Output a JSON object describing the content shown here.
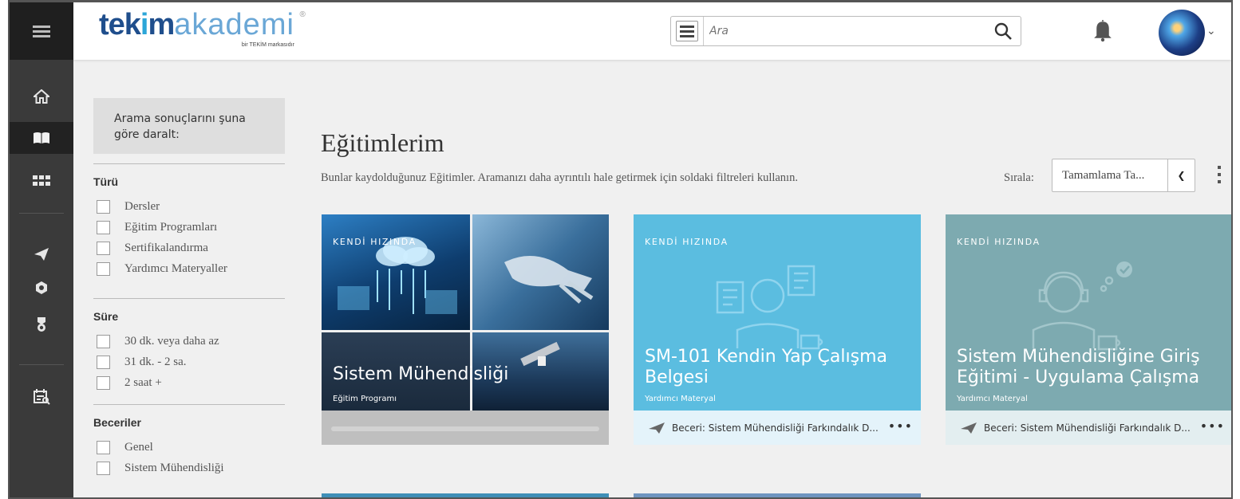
{
  "header": {
    "logo_brand_a": "tek",
    "logo_brand_i": "i",
    "logo_brand_b": "m",
    "logo_brand_c": "akademi",
    "logo_reg": "®",
    "logo_sub": "bir TEKİM markasıdır",
    "search_placeholder": "Ara"
  },
  "filters": {
    "heading": "Arama sonuçlarını şuna göre daralt:",
    "sections": [
      {
        "title": "Türü",
        "options": [
          "Dersler",
          "Eğitim Programları",
          "Sertifikalandırma",
          "Yardımcı Materyaller"
        ]
      },
      {
        "title": "Süre",
        "options": [
          "30 dk. veya daha az",
          "31 dk. - 2 sa.",
          "2 saat +"
        ]
      },
      {
        "title": "Beceriler",
        "options": [
          "Genel",
          "Sistem Mühendisliği"
        ]
      }
    ]
  },
  "main": {
    "title": "Eğitimlerim",
    "description": "Bunlar kaydolduğunuz Eğitimler. Aramanızı daha ayrıntılı hale getirmek için soldaki filtreleri kullanın.",
    "sort_label": "Sırala:",
    "sort_value": "Tamamlama Ta..."
  },
  "cards": [
    {
      "tag": "KENDİ HIZINDA",
      "title": "Sistem Mühendisliği",
      "type": "Eğitim Programı"
    },
    {
      "tag": "KENDİ HIZINDA",
      "title": "SM-101 Kendin Yap Çalışma Belgesi",
      "type": "Yardımcı Materyal",
      "skill": "Beceri: Sistem Mühendisliği Farkındalık D...",
      "more": "•••",
      "color": "#5bbde0"
    },
    {
      "tag": "KENDİ HIZINDA",
      "title": "Sistem Mühendisliğine Giriş Eğitimi - Uygulama Çalışma",
      "type": "Yardımcı Materyal",
      "skill": "Beceri: Sistem Mühendisliği Farkındalık D...",
      "more": "•••",
      "color": "#7daab0"
    }
  ],
  "colors": {
    "rail": "#3a3a3a",
    "brand": "#1f4e8c",
    "card2": "#5bbde0",
    "card3": "#7daab0"
  }
}
